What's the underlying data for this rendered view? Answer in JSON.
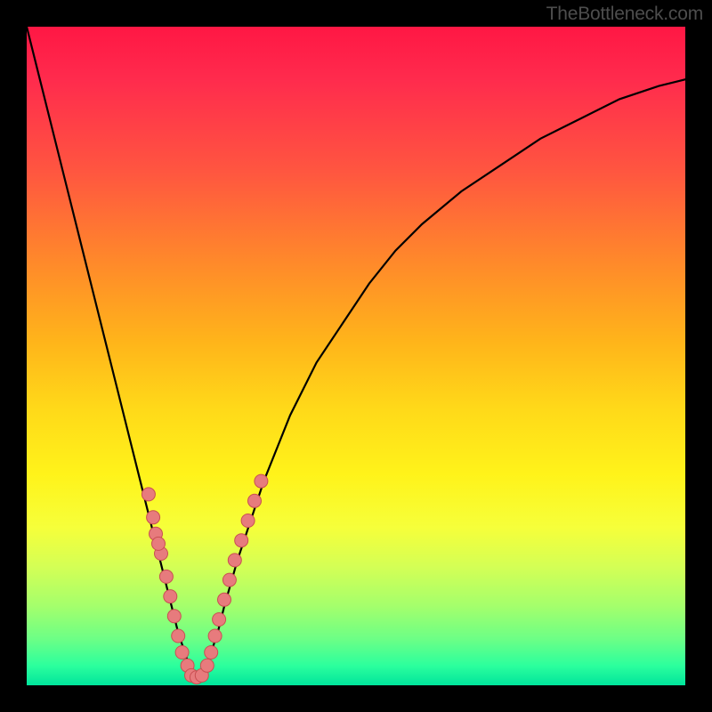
{
  "watermark": "TheBottleneck.com",
  "accent_colors": {
    "top": "#ff1744",
    "bottom": "#00e59c",
    "curve": "#000000",
    "dot_fill": "#e77b7d",
    "dot_stroke": "#c94f52"
  },
  "chart_data": {
    "type": "line",
    "title": "",
    "xlabel": "",
    "ylabel": "",
    "xlim": [
      0,
      100
    ],
    "ylim": [
      0,
      100
    ],
    "grid": false,
    "legend": false,
    "series": [
      {
        "name": "bottleneck_curve",
        "x": [
          0,
          2,
          4,
          6,
          8,
          10,
          12,
          14,
          16,
          18,
          20,
          21,
          22,
          23,
          24,
          25,
          26,
          27,
          28,
          29,
          30,
          32,
          34,
          36,
          38,
          40,
          44,
          48,
          52,
          56,
          60,
          66,
          72,
          78,
          84,
          90,
          96,
          100
        ],
        "values": [
          100,
          92,
          84,
          76,
          68,
          60,
          52,
          44,
          36,
          28,
          20,
          16,
          12,
          8,
          5,
          2,
          1,
          2,
          5,
          8,
          12,
          19,
          25,
          31,
          36,
          41,
          49,
          55,
          61,
          66,
          70,
          75,
          79,
          83,
          86,
          89,
          91,
          92
        ],
        "note": "curve is a sharp V funnel; values estimated by pixel position, 0=bottom 100=top"
      }
    ],
    "dots_left": [
      {
        "x": 18.5,
        "y": 29
      },
      {
        "x": 19.2,
        "y": 25.5
      },
      {
        "x": 19.6,
        "y": 23
      },
      {
        "x": 20.4,
        "y": 20
      },
      {
        "x": 20.0,
        "y": 21.5
      },
      {
        "x": 21.2,
        "y": 16.5
      },
      {
        "x": 21.8,
        "y": 13.5
      },
      {
        "x": 22.4,
        "y": 10.5
      },
      {
        "x": 23.0,
        "y": 7.5
      },
      {
        "x": 23.6,
        "y": 5
      },
      {
        "x": 24.4,
        "y": 3
      }
    ],
    "dots_right": [
      {
        "x": 27.4,
        "y": 3
      },
      {
        "x": 28.0,
        "y": 5
      },
      {
        "x": 28.6,
        "y": 7.5
      },
      {
        "x": 29.2,
        "y": 10
      },
      {
        "x": 30.0,
        "y": 13
      },
      {
        "x": 30.8,
        "y": 16
      },
      {
        "x": 31.6,
        "y": 19
      },
      {
        "x": 32.6,
        "y": 22
      },
      {
        "x": 33.6,
        "y": 25
      },
      {
        "x": 34.6,
        "y": 28
      },
      {
        "x": 35.6,
        "y": 31
      }
    ],
    "dots_bottom": [
      {
        "x": 25.0,
        "y": 1.5
      },
      {
        "x": 25.8,
        "y": 1.2
      },
      {
        "x": 26.6,
        "y": 1.5
      }
    ]
  }
}
